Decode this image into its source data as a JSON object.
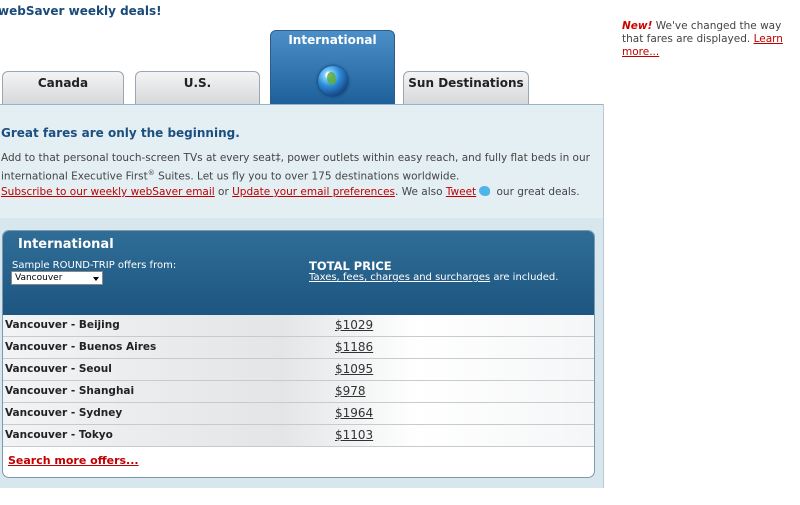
{
  "page": {
    "heading": "webSaver weekly deals!"
  },
  "notice": {
    "new_label": "New!",
    "text": " We've changed the way that fares are displayed. ",
    "link": "Learn more..."
  },
  "tabs": {
    "canada": "Canada",
    "us": "U.S.",
    "international": "International",
    "sun": "Sun Destinations",
    "active": "International"
  },
  "intro": {
    "title": "Great fares are only the beginning.",
    "body_part1": "Add to that personal touch-screen TVs at every seat‡, power outlets within easy reach, and fully flat beds in our international Executive First",
    "body_reg": "®",
    "body_part2": " Suites. Let us fly you to over 175 destinations worldwide.",
    "subscribe_link": "Subscribe to our weekly webSaver email",
    "or_text": " or ",
    "update_link": "Update your email preferences",
    "also_text": ". We also ",
    "tweet_link": "Tweet",
    "after_tweet": " our great deals."
  },
  "fares": {
    "title": "International",
    "sample_label": "Sample ROUND-TRIP offers from:",
    "selected_city": "Vancouver",
    "total_title": "TOTAL PRICE",
    "total_note_link": "Taxes, fees, charges and surcharges",
    "total_note_rest": " are included.",
    "rows": [
      {
        "route": "Vancouver - Beijing",
        "price": "$1029"
      },
      {
        "route": "Vancouver - Buenos Aires",
        "price": "$1186"
      },
      {
        "route": "Vancouver - Seoul",
        "price": "$1095"
      },
      {
        "route": "Vancouver - Shanghai",
        "price": "$978"
      },
      {
        "route": "Vancouver - Sydney",
        "price": "$1964"
      },
      {
        "route": "Vancouver - Tokyo",
        "price": "$1103"
      }
    ],
    "search_more": "Search more offers..."
  },
  "colors": {
    "brand_blue": "#1d5680",
    "link_red": "#c00000",
    "panel_bg": "#e4eff4"
  }
}
